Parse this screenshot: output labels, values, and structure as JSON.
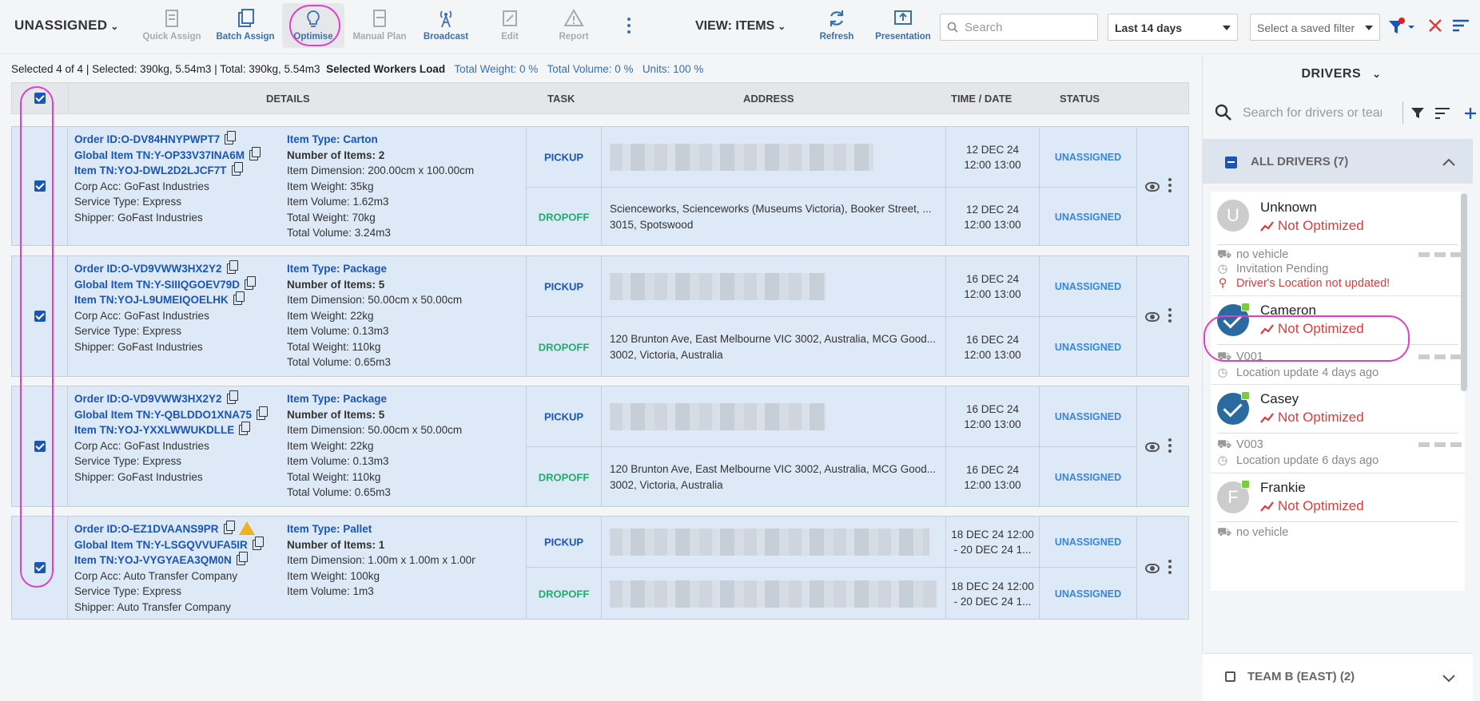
{
  "toolbar": {
    "assign_dropdown": "UNASSIGNED",
    "buttons": [
      {
        "label": "Quick Assign",
        "icon": "quick-assign-icon"
      },
      {
        "label": "Batch Assign",
        "icon": "batch-assign-icon"
      },
      {
        "label": "Optimise",
        "icon": "lightbulb-icon"
      },
      {
        "label": "Manual Plan",
        "icon": "manual-plan-icon"
      },
      {
        "label": "Broadcast",
        "icon": "broadcast-icon"
      },
      {
        "label": "Edit",
        "icon": "edit-icon"
      },
      {
        "label": "Report",
        "icon": "warning-icon"
      }
    ],
    "view": "VIEW: ITEMS",
    "refresh": "Refresh",
    "presentation": "Presentation",
    "search_placeholder": "Search",
    "date_range": "Last 14 days",
    "saved_filter_placeholder": "Select a saved filter"
  },
  "summary": {
    "selected": "Selected 4 of 4",
    "selected_load": "Selected: 390kg, 5.54m3",
    "total": "Total: 390kg, 5.54m3",
    "workers_load": "Selected Workers Load",
    "total_weight": "Total Weight: 0 %",
    "total_volume": "Total Volume: 0 %",
    "units": "Units: 100 %"
  },
  "table": {
    "headers": {
      "details": "DETAILS",
      "task": "TASK",
      "address": "ADDRESS",
      "time": "TIME / DATE",
      "status": "STATUS"
    },
    "rows": [
      {
        "order_id": "Order ID:O-DV84HNYPWPT7",
        "global_tn": "Global Item TN:Y-OP33V37INA6M",
        "item_tn": "Item TN:YOJ-DWL2D2LJCF7T",
        "corp": "Corp Acc: GoFast Industries",
        "service": "Service Type: Express",
        "shipper": "Shipper: GoFast Industries",
        "item_type": "Item Type: Carton",
        "num_items": "Number of Items: 2",
        "dimension": "Item Dimension: 200.00cm x 100.00cm",
        "weight": "Item Weight: 35kg",
        "volume": "Item Volume: 1.62m3",
        "total_weight": "Total Weight: 70kg",
        "total_volume": "Total Volume: 3.24m3",
        "pickup": {
          "task": "PICKUP",
          "addr1": "",
          "addr2": "",
          "date": "12 DEC 24",
          "time": "12:00 13:00",
          "status": "UNASSIGNED"
        },
        "dropoff": {
          "task": "DROPOFF",
          "addr1": "Scienceworks, Scienceworks (Museums Victoria), Booker Street, ...",
          "addr2": "3015, Spotswood",
          "date": "12 DEC 24",
          "time": "12:00 13:00",
          "status": "UNASSIGNED"
        }
      },
      {
        "order_id": "Order ID:O-VD9VWW3HX2Y2",
        "global_tn": "Global Item TN:Y-SIIIQGOEV79D",
        "item_tn": "Item TN:YOJ-L9UMEIQOELHK",
        "corp": "Corp Acc: GoFast Industries",
        "service": "Service Type: Express",
        "shipper": "Shipper: GoFast Industries",
        "item_type": "Item Type: Package",
        "num_items": "Number of Items: 5",
        "dimension": "Item Dimension: 50.00cm x 50.00cm",
        "weight": "Item Weight: 22kg",
        "volume": "Item Volume: 0.13m3",
        "total_weight": "Total Weight: 110kg",
        "total_volume": "Total Volume: 0.65m3",
        "pickup": {
          "task": "PICKUP",
          "addr1": "",
          "addr2": "",
          "date": "16 DEC 24",
          "time": "12:00 13:00",
          "status": "UNASSIGNED"
        },
        "dropoff": {
          "task": "DROPOFF",
          "addr1": "120 Brunton Ave, East Melbourne VIC 3002, Australia, MCG Good...",
          "addr2": "3002, Victoria, Australia",
          "date": "16 DEC 24",
          "time": "12:00 13:00",
          "status": "UNASSIGNED"
        }
      },
      {
        "order_id": "Order ID:O-VD9VWW3HX2Y2",
        "global_tn": "Global Item TN:Y-QBLDDO1XNA75",
        "item_tn": "Item TN:YOJ-YXXLWWUKDLLE",
        "corp": "Corp Acc: GoFast Industries",
        "service": "Service Type: Express",
        "shipper": "Shipper: GoFast Industries",
        "item_type": "Item Type: Package",
        "num_items": "Number of Items: 5",
        "dimension": "Item Dimension: 50.00cm x 50.00cm",
        "weight": "Item Weight: 22kg",
        "volume": "Item Volume: 0.13m3",
        "total_weight": "Total Weight: 110kg",
        "total_volume": "Total Volume: 0.65m3",
        "pickup": {
          "task": "PICKUP",
          "addr1": "",
          "addr2": "",
          "date": "16 DEC 24",
          "time": "12:00 13:00",
          "status": "UNASSIGNED"
        },
        "dropoff": {
          "task": "DROPOFF",
          "addr1": "120 Brunton Ave, East Melbourne VIC 3002, Australia, MCG Good...",
          "addr2": "3002, Victoria, Australia",
          "date": "16 DEC 24",
          "time": "12:00 13:00",
          "status": "UNASSIGNED"
        }
      },
      {
        "order_id": "Order ID:O-EZ1DVAANS9PR",
        "global_tn": "Global Item TN:Y-LSGQVVUFA5IR",
        "item_tn": "Item TN:YOJ-VYGYAEA3QM0N",
        "corp": "Corp Acc: Auto Transfer Company",
        "service": "Service Type: Express",
        "shipper": "Shipper: Auto Transfer Company",
        "item_type": "Item Type: Pallet",
        "num_items": "Number of Items: 1",
        "dimension": "Item Dimension: 1.00m x 1.00m x 1.00m",
        "weight": "Item Weight: 100kg",
        "volume": "Item Volume: 1m3",
        "total_weight": "",
        "total_volume": "",
        "pickup": {
          "task": "PICKUP",
          "addr1": "",
          "addr2": "",
          "date": "18 DEC 24 12:00",
          "time": "- 20 DEC 24 1...",
          "status": "UNASSIGNED"
        },
        "dropoff": {
          "task": "DROPOFF",
          "addr1": "",
          "addr2": "",
          "date": "18 DEC 24 12:00",
          "time": "- 20 DEC 24 1...",
          "status": "UNASSIGNED"
        }
      }
    ]
  },
  "drivers": {
    "title": "DRIVERS",
    "search_placeholder": "Search for drivers or teams",
    "all_drivers": "ALL DRIVERS (7)",
    "list": [
      {
        "initial": "U",
        "name": "Unknown",
        "status": "Not Optimized",
        "vehicle": "no vehicle",
        "meta2": "Invitation Pending",
        "meta3": "Driver's Location not updated!"
      },
      {
        "initial": "",
        "name": "Cameron",
        "status": "Not Optimized",
        "vehicle": "V001",
        "meta2": "Location update 4 days ago",
        "meta3": ""
      },
      {
        "initial": "",
        "name": "Casey",
        "status": "Not Optimized",
        "vehicle": "V003",
        "meta2": "Location update 6 days ago",
        "meta3": ""
      },
      {
        "initial": "F",
        "name": "Frankie",
        "status": "Not Optimized",
        "vehicle": "no vehicle",
        "meta2": "",
        "meta3": ""
      }
    ],
    "team_b": "TEAM B (EAST) (2)"
  },
  "colors": {
    "accent": "#1b55b5",
    "pickup": "#1b55b5",
    "dropoff": "#27a86f",
    "status": "#3a86d8",
    "not_optimized": "#e03a3a",
    "annotation": "#e040c8"
  }
}
